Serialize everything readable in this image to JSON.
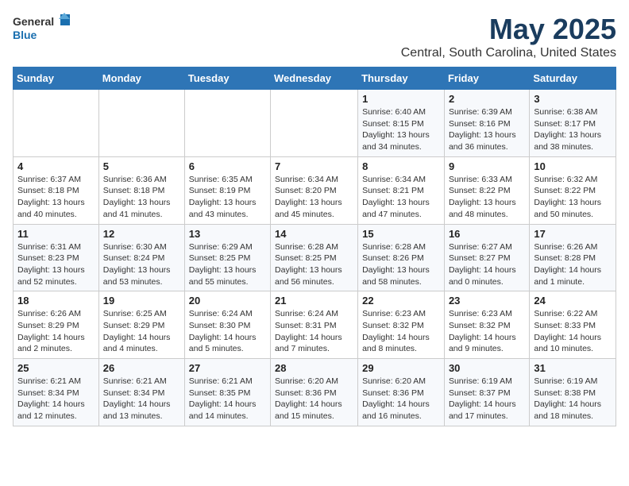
{
  "logo": {
    "general": "General",
    "blue": "Blue"
  },
  "title": "May 2025",
  "subtitle": "Central, South Carolina, United States",
  "days_of_week": [
    "Sunday",
    "Monday",
    "Tuesday",
    "Wednesday",
    "Thursday",
    "Friday",
    "Saturday"
  ],
  "weeks": [
    [
      {
        "day": "",
        "info": ""
      },
      {
        "day": "",
        "info": ""
      },
      {
        "day": "",
        "info": ""
      },
      {
        "day": "",
        "info": ""
      },
      {
        "day": "1",
        "info": "Sunrise: 6:40 AM\nSunset: 8:15 PM\nDaylight: 13 hours\nand 34 minutes."
      },
      {
        "day": "2",
        "info": "Sunrise: 6:39 AM\nSunset: 8:16 PM\nDaylight: 13 hours\nand 36 minutes."
      },
      {
        "day": "3",
        "info": "Sunrise: 6:38 AM\nSunset: 8:17 PM\nDaylight: 13 hours\nand 38 minutes."
      }
    ],
    [
      {
        "day": "4",
        "info": "Sunrise: 6:37 AM\nSunset: 8:18 PM\nDaylight: 13 hours\nand 40 minutes."
      },
      {
        "day": "5",
        "info": "Sunrise: 6:36 AM\nSunset: 8:18 PM\nDaylight: 13 hours\nand 41 minutes."
      },
      {
        "day": "6",
        "info": "Sunrise: 6:35 AM\nSunset: 8:19 PM\nDaylight: 13 hours\nand 43 minutes."
      },
      {
        "day": "7",
        "info": "Sunrise: 6:34 AM\nSunset: 8:20 PM\nDaylight: 13 hours\nand 45 minutes."
      },
      {
        "day": "8",
        "info": "Sunrise: 6:34 AM\nSunset: 8:21 PM\nDaylight: 13 hours\nand 47 minutes."
      },
      {
        "day": "9",
        "info": "Sunrise: 6:33 AM\nSunset: 8:22 PM\nDaylight: 13 hours\nand 48 minutes."
      },
      {
        "day": "10",
        "info": "Sunrise: 6:32 AM\nSunset: 8:22 PM\nDaylight: 13 hours\nand 50 minutes."
      }
    ],
    [
      {
        "day": "11",
        "info": "Sunrise: 6:31 AM\nSunset: 8:23 PM\nDaylight: 13 hours\nand 52 minutes."
      },
      {
        "day": "12",
        "info": "Sunrise: 6:30 AM\nSunset: 8:24 PM\nDaylight: 13 hours\nand 53 minutes."
      },
      {
        "day": "13",
        "info": "Sunrise: 6:29 AM\nSunset: 8:25 PM\nDaylight: 13 hours\nand 55 minutes."
      },
      {
        "day": "14",
        "info": "Sunrise: 6:28 AM\nSunset: 8:25 PM\nDaylight: 13 hours\nand 56 minutes."
      },
      {
        "day": "15",
        "info": "Sunrise: 6:28 AM\nSunset: 8:26 PM\nDaylight: 13 hours\nand 58 minutes."
      },
      {
        "day": "16",
        "info": "Sunrise: 6:27 AM\nSunset: 8:27 PM\nDaylight: 14 hours\nand 0 minutes."
      },
      {
        "day": "17",
        "info": "Sunrise: 6:26 AM\nSunset: 8:28 PM\nDaylight: 14 hours\nand 1 minute."
      }
    ],
    [
      {
        "day": "18",
        "info": "Sunrise: 6:26 AM\nSunset: 8:29 PM\nDaylight: 14 hours\nand 2 minutes."
      },
      {
        "day": "19",
        "info": "Sunrise: 6:25 AM\nSunset: 8:29 PM\nDaylight: 14 hours\nand 4 minutes."
      },
      {
        "day": "20",
        "info": "Sunrise: 6:24 AM\nSunset: 8:30 PM\nDaylight: 14 hours\nand 5 minutes."
      },
      {
        "day": "21",
        "info": "Sunrise: 6:24 AM\nSunset: 8:31 PM\nDaylight: 14 hours\nand 7 minutes."
      },
      {
        "day": "22",
        "info": "Sunrise: 6:23 AM\nSunset: 8:32 PM\nDaylight: 14 hours\nand 8 minutes."
      },
      {
        "day": "23",
        "info": "Sunrise: 6:23 AM\nSunset: 8:32 PM\nDaylight: 14 hours\nand 9 minutes."
      },
      {
        "day": "24",
        "info": "Sunrise: 6:22 AM\nSunset: 8:33 PM\nDaylight: 14 hours\nand 10 minutes."
      }
    ],
    [
      {
        "day": "25",
        "info": "Sunrise: 6:21 AM\nSunset: 8:34 PM\nDaylight: 14 hours\nand 12 minutes."
      },
      {
        "day": "26",
        "info": "Sunrise: 6:21 AM\nSunset: 8:34 PM\nDaylight: 14 hours\nand 13 minutes."
      },
      {
        "day": "27",
        "info": "Sunrise: 6:21 AM\nSunset: 8:35 PM\nDaylight: 14 hours\nand 14 minutes."
      },
      {
        "day": "28",
        "info": "Sunrise: 6:20 AM\nSunset: 8:36 PM\nDaylight: 14 hours\nand 15 minutes."
      },
      {
        "day": "29",
        "info": "Sunrise: 6:20 AM\nSunset: 8:36 PM\nDaylight: 14 hours\nand 16 minutes."
      },
      {
        "day": "30",
        "info": "Sunrise: 6:19 AM\nSunset: 8:37 PM\nDaylight: 14 hours\nand 17 minutes."
      },
      {
        "day": "31",
        "info": "Sunrise: 6:19 AM\nSunset: 8:38 PM\nDaylight: 14 hours\nand 18 minutes."
      }
    ]
  ]
}
